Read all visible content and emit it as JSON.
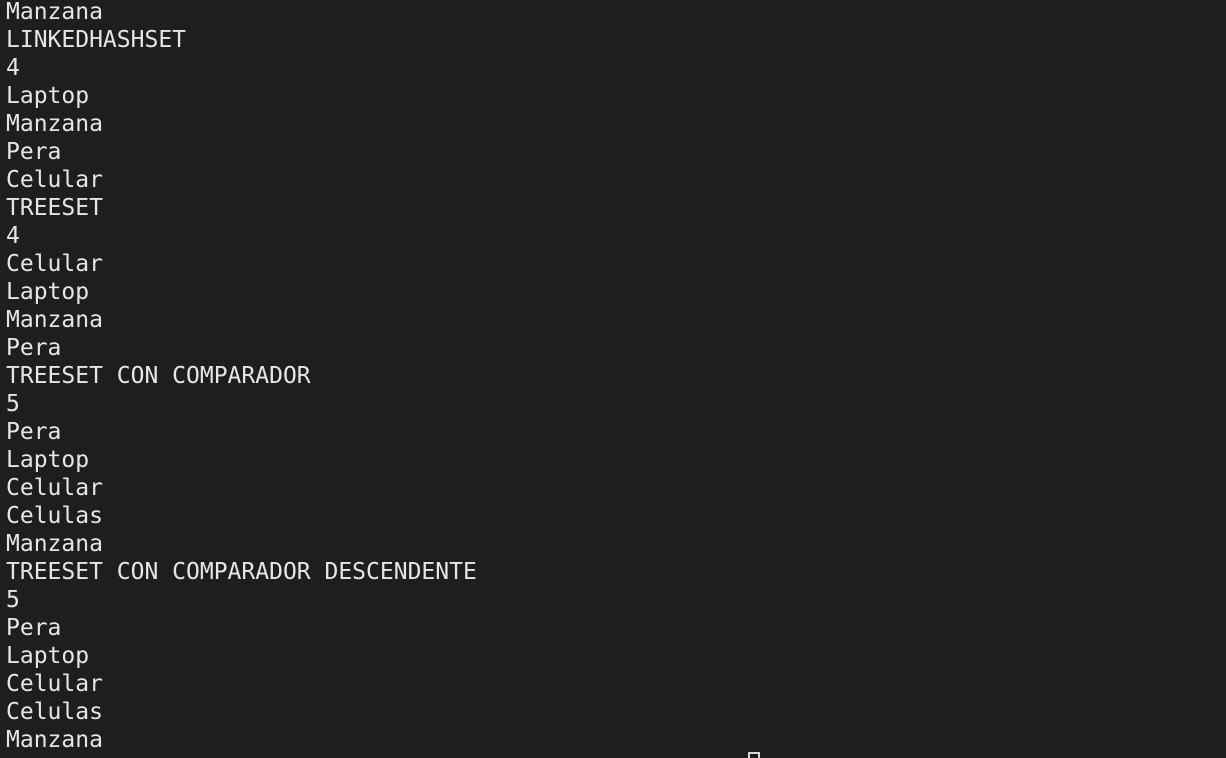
{
  "terminal": {
    "lines": [
      "Manzana",
      "LINKEDHASHSET",
      "4",
      "Laptop",
      "Manzana",
      "Pera",
      "Celular",
      "TREESET",
      "4",
      "Celular",
      "Laptop",
      "Manzana",
      "Pera",
      "TREESET CON COMPARADOR",
      "5",
      "Pera",
      "Laptop",
      "Celular",
      "Celulas",
      "Manzana",
      "TREESET CON COMPARADOR DESCENDENTE",
      "5",
      "Pera",
      "Laptop",
      "Celular",
      "Celulas",
      "Manzana"
    ]
  }
}
